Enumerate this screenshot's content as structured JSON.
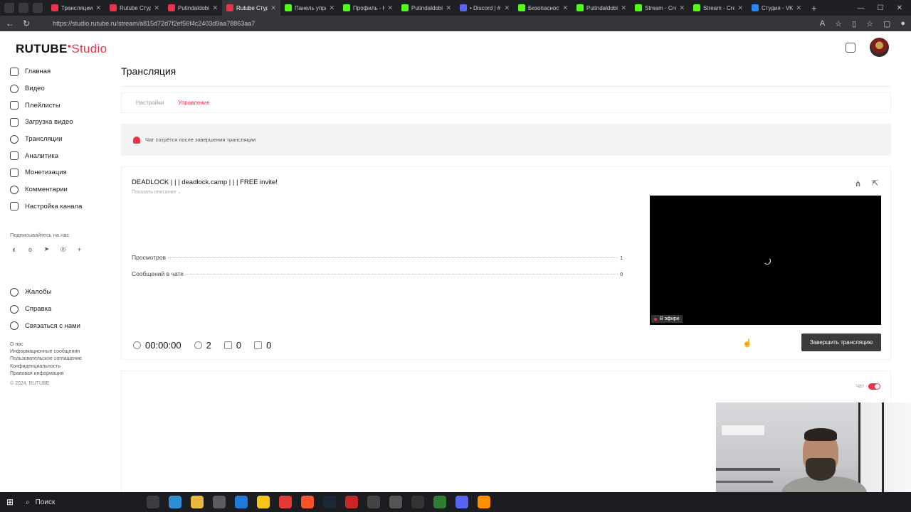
{
  "browser": {
    "tabs": [
      {
        "title": "Трансляции",
        "color": "#e7344a"
      },
      {
        "title": "Rutube Студия",
        "color": "#e7344a"
      },
      {
        "title": "Putindaldobi",
        "color": "#e7344a"
      },
      {
        "title": "Rutube Студия",
        "color": "#e7344a",
        "active": true
      },
      {
        "title": "Панель упра",
        "color": "#53fc18"
      },
      {
        "title": "Профиль - K",
        "color": "#53fc18"
      },
      {
        "title": "Putindaldobi",
        "color": "#53fc18"
      },
      {
        "title": "• Discord | #",
        "color": "#5865f2"
      },
      {
        "title": "Безопасност",
        "color": "#53fc18"
      },
      {
        "title": "Putindaldobi",
        "color": "#53fc18"
      },
      {
        "title": "Stream - Cre",
        "color": "#53fc18"
      },
      {
        "title": "Stream - Cre",
        "color": "#53fc18"
      },
      {
        "title": "Студия - VK",
        "color": "#2787f5"
      }
    ],
    "url": "https://studio.rutube.ru/stream/a815d72d7f2ef56f4c2403d9aa78863aa7"
  },
  "header": {
    "logo_main": "RUTUBE",
    "logo_studio": "Studio"
  },
  "sidebar": {
    "items": [
      {
        "label": "Главная",
        "icon": "home-icon"
      },
      {
        "label": "Видео",
        "icon": "video-icon"
      },
      {
        "label": "Плейлисты",
        "icon": "playlist-icon"
      },
      {
        "label": "Загрузка видео",
        "icon": "upload-icon"
      },
      {
        "label": "Трансляции",
        "icon": "broadcast-icon"
      },
      {
        "label": "Аналитика",
        "icon": "analytics-icon"
      },
      {
        "label": "Монетизация",
        "icon": "money-icon"
      },
      {
        "label": "Комментарии",
        "icon": "comment-icon"
      },
      {
        "label": "Настройка канала",
        "icon": "settings-icon"
      }
    ],
    "subscribe_label": "Подписывайтесь на нас",
    "socials": [
      "vk",
      "ok",
      "telegram",
      "viber",
      "+"
    ],
    "help_items": [
      {
        "label": "Жалобы",
        "icon": "flag-icon"
      },
      {
        "label": "Справка",
        "icon": "help-icon"
      },
      {
        "label": "Связаться с нами",
        "icon": "mail-icon"
      }
    ],
    "footer_links": [
      "О нас",
      "Информационные сообщения",
      "Пользовательское соглашение",
      "Конфиденциальность",
      "Правовая информация",
      "© 2024, RUTUBE"
    ]
  },
  "main": {
    "page_title": "Трансляция",
    "tabs": [
      {
        "label": "Настройки",
        "active": false
      },
      {
        "label": "Управление",
        "active": true
      }
    ],
    "notice": "Чат сотрётся после завершения трансляции",
    "stream": {
      "title": "DEADLOCK | | | deadlock.camp | | | FREE invite!",
      "show_description": "Показать описание",
      "stats": [
        {
          "label": "Просмотров",
          "value": "1"
        },
        {
          "label": "Сообщений в чате",
          "value": "0"
        }
      ],
      "live_badge": "В эфире",
      "duration": "00:00:00",
      "viewers": "2",
      "likes": "0",
      "dislikes": "0",
      "end_button": "Завершить трансляцию"
    },
    "chat": {
      "toggle_label": "Чат",
      "enabled": true
    }
  },
  "taskbar": {
    "search_label": "Поиск"
  },
  "colors": {
    "accent": "#e7344a",
    "button_dark": "#3b3b3d"
  }
}
